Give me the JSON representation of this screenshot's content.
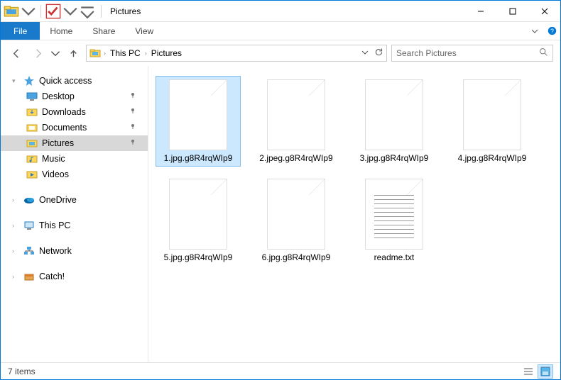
{
  "window": {
    "title": "Pictures"
  },
  "ribbon": {
    "file": "File",
    "tabs": [
      "Home",
      "Share",
      "View"
    ]
  },
  "breadcrumb": {
    "root_icon": "explorer-icon",
    "items": [
      "This PC",
      "Pictures"
    ]
  },
  "search": {
    "placeholder": "Search Pictures"
  },
  "sidebar": {
    "quick_access": {
      "label": "Quick access",
      "items": [
        {
          "label": "Desktop",
          "icon": "desktop-icon",
          "pinned": true
        },
        {
          "label": "Downloads",
          "icon": "downloads-icon",
          "pinned": true
        },
        {
          "label": "Documents",
          "icon": "documents-icon",
          "pinned": true
        },
        {
          "label": "Pictures",
          "icon": "pictures-icon",
          "pinned": true,
          "selected": true
        },
        {
          "label": "Music",
          "icon": "music-icon",
          "pinned": false
        },
        {
          "label": "Videos",
          "icon": "videos-icon",
          "pinned": false
        }
      ]
    },
    "roots": [
      {
        "label": "OneDrive",
        "icon": "onedrive-icon"
      },
      {
        "label": "This PC",
        "icon": "thispc-icon"
      },
      {
        "label": "Network",
        "icon": "network-icon"
      },
      {
        "label": "Catch!",
        "icon": "catch-icon"
      }
    ]
  },
  "files": [
    {
      "name": "1.jpg.g8R4rqWIp9",
      "type": "file",
      "selected": true
    },
    {
      "name": "2.jpeg.g8R4rqWIp9",
      "type": "file"
    },
    {
      "name": "3.jpg.g8R4rqWIp9",
      "type": "file"
    },
    {
      "name": "4.jpg.g8R4rqWIp9",
      "type": "file"
    },
    {
      "name": "5.jpg.g8R4rqWIp9",
      "type": "file"
    },
    {
      "name": "6.jpg.g8R4rqWIp9",
      "type": "file"
    },
    {
      "name": "readme.txt",
      "type": "text"
    }
  ],
  "status": {
    "count_label": "7 items"
  }
}
